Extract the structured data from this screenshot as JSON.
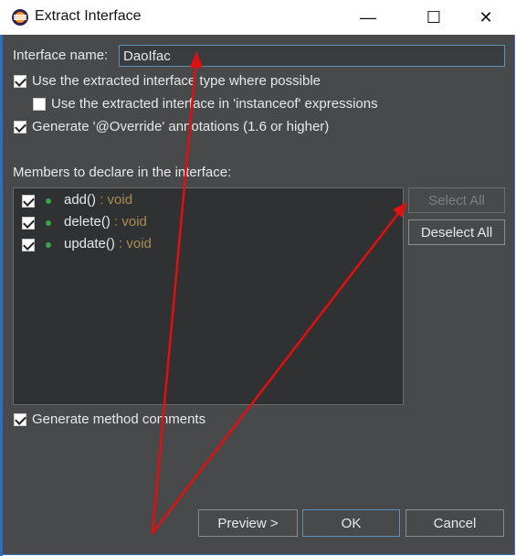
{
  "window": {
    "title": "Extract Interface",
    "minimize_glyph": "—",
    "maximize_glyph": "☐",
    "close_glyph": "✕"
  },
  "form": {
    "interface_name_label": "Interface name:",
    "interface_name_value": "DaoIfac",
    "use_extracted_type": {
      "label": "Use the extracted interface type where possible",
      "checked": true
    },
    "use_in_instanceof": {
      "label": "Use the extracted interface in 'instanceof' expressions",
      "checked": false
    },
    "generate_override": {
      "label": "Generate '@Override' annotations (1.6 or higher)",
      "checked": true
    },
    "members_label": "Members to declare in the interface:",
    "generate_comments": {
      "label": "Generate method comments",
      "checked": true
    }
  },
  "members": [
    {
      "name": "add()",
      "type": " : void",
      "checked": true
    },
    {
      "name": "delete()",
      "type": " : void",
      "checked": true
    },
    {
      "name": "update()",
      "type": " : void",
      "checked": true
    }
  ],
  "buttons": {
    "select_all": "Select All",
    "deselect_all": "Deselect All",
    "preview": "Preview >",
    "ok": "OK",
    "cancel": "Cancel"
  },
  "colors": {
    "dialog_bg": "#47494b",
    "list_bg": "#2f3133",
    "annotation_red": "#e01010",
    "method_dot": "#3aa34a",
    "return_type": "#a88d55"
  },
  "icons": {
    "app": "eclipse-icon",
    "method": "public-method-icon"
  }
}
